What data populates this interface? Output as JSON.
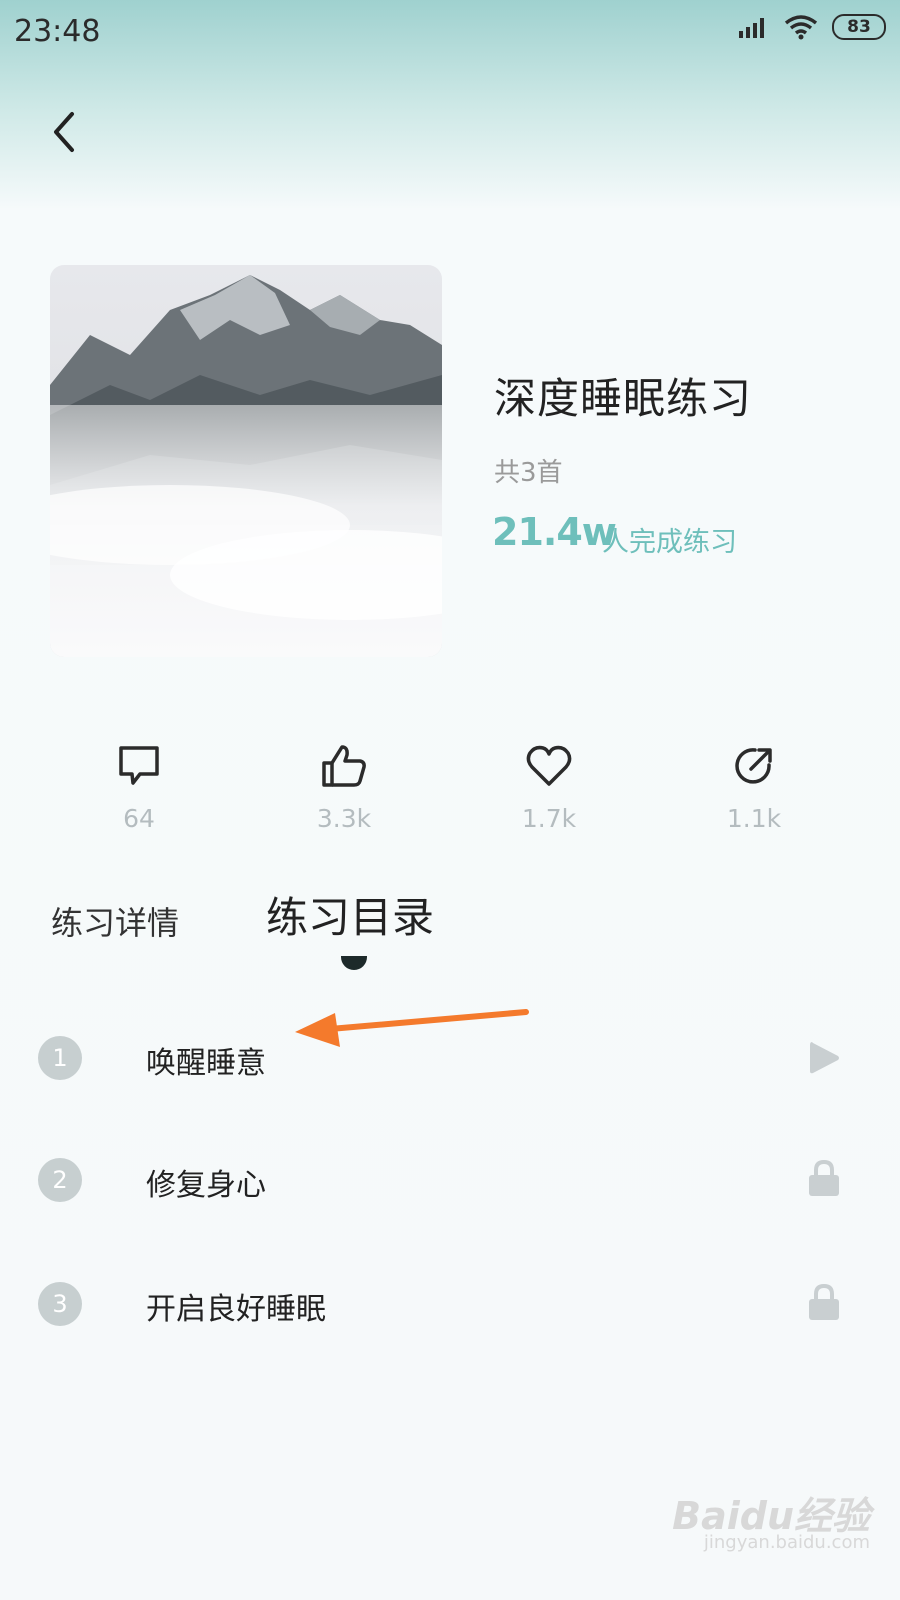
{
  "status": {
    "time": "23:48",
    "battery": "83"
  },
  "album": {
    "title": "深度睡眠练习",
    "count": "共3首",
    "completed_number": "21.4w",
    "completed_label": "人完成练习"
  },
  "actions": [
    {
      "icon": "comment-icon",
      "count": "64"
    },
    {
      "icon": "thumbs-up-icon",
      "count": "3.3k"
    },
    {
      "icon": "heart-icon",
      "count": "1.7k"
    },
    {
      "icon": "share-icon",
      "count": "1.1k"
    }
  ],
  "tabs": [
    {
      "label": "练习详情"
    },
    {
      "label": "练习目录",
      "active": true
    }
  ],
  "tracks": [
    {
      "index": "1",
      "title": "唤醒睡意",
      "status": "play-icon"
    },
    {
      "index": "2",
      "title": "修复身心",
      "status": "lock-icon"
    },
    {
      "index": "3",
      "title": "开启良好睡眠",
      "status": "lock-icon"
    }
  ],
  "colors": {
    "accent": "#6ebfbb",
    "annotation_arrow": "#f47a2c"
  },
  "watermark": {
    "main": "Baidu经验",
    "sub": "jingyan.baidu.com"
  }
}
